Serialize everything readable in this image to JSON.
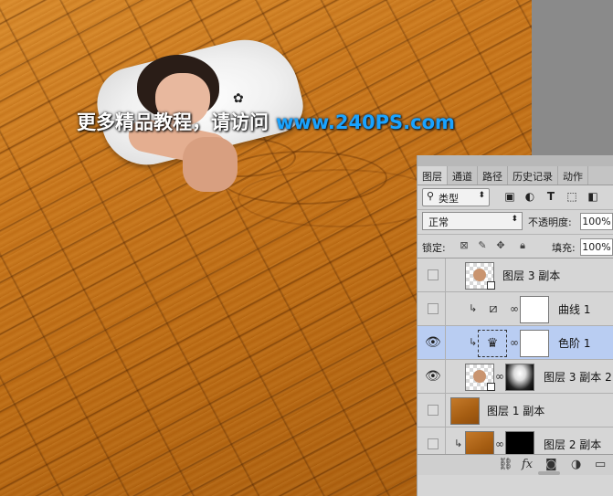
{
  "watermark": {
    "cn": "更多精品教程，请访问",
    "url": "www.240PS.com"
  },
  "panel": {
    "tabs": [
      "图层",
      "通道",
      "路径",
      "历史记录",
      "动作"
    ],
    "filter_kind": "类型",
    "blend_mode": "正常",
    "opacity_label": "不透明度:",
    "opacity_value": "100%",
    "lock_label": "锁定:",
    "fill_label": "填充:",
    "fill_value": "100%",
    "layers": [
      {
        "name": "图层 3 副本",
        "visible": false,
        "selected": false
      },
      {
        "name": "曲线 1",
        "visible": false,
        "selected": false
      },
      {
        "name": "色阶 1",
        "visible": true,
        "selected": true
      },
      {
        "name": "图层 3 副本 2",
        "visible": true,
        "selected": false
      },
      {
        "name": "图层 1 副本",
        "visible": false,
        "selected": false
      },
      {
        "name": "图层 2 副本",
        "visible": false,
        "selected": false
      }
    ],
    "icons": {
      "filter": [
        "image-filter-icon",
        "adjustment-filter-icon",
        "type-filter-icon",
        "shape-filter-icon",
        "smart-object-filter-icon"
      ],
      "lock": [
        "lock-transparent-icon",
        "lock-paint-icon",
        "lock-position-icon",
        "lock-all-icon"
      ],
      "bottom": [
        "link-layers-icon",
        "fx-icon",
        "add-mask-icon",
        "new-adjustment-icon",
        "new-group-icon"
      ]
    }
  }
}
